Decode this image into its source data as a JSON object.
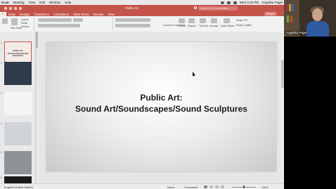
{
  "menubar": {
    "app": "m.us",
    "items": [
      "Meeting",
      "View",
      "Edit",
      "Window",
      "Help"
    ],
    "status_text": "Wed 3:16 PM",
    "user": "Angelika Pagel"
  },
  "window": {
    "title": "Public Art",
    "search_placeholder": "Search in Presentation"
  },
  "ribbon_tabs": [
    "e",
    "Draw",
    "Design",
    "Transitions",
    "Animations",
    "Slide Show",
    "Review",
    "View"
  ],
  "active_tab_index": 0,
  "share_label": "Share",
  "ribbon": {
    "layout_label": "Layout",
    "reset_label": "Reset",
    "section_label": "Section",
    "new_slide_label": "New Slide",
    "picture_label": "Picture",
    "shapes_label": "Shapes",
    "text_box_label": "Text Box",
    "convert_label": "Convert to SmartArt",
    "arrange_label": "Arrange",
    "quick_styles_label": "Quick Styles",
    "shape_fill_label": "Shape Fill",
    "shape_outline_label": "Shape Outline"
  },
  "thumbnails": [
    {
      "num": "1",
      "text": "Public Art: Soundscapes/Sound Sculptures",
      "bg": "#f4ece6",
      "selected": true
    },
    {
      "num": "2",
      "text": "",
      "bg": "#2f3a4a",
      "selected": false
    },
    {
      "num": "3",
      "text": "",
      "bg": "#f5f5f5",
      "selected": false
    },
    {
      "num": "4",
      "text": "",
      "bg": "#d0d4d8",
      "selected": false
    },
    {
      "num": "5",
      "text": "",
      "bg": "#8e9296",
      "selected": false
    },
    {
      "num": "6",
      "text": "",
      "bg": "#1a1a1a",
      "selected": false
    }
  ],
  "slide": {
    "title_line1": "Public Art:",
    "title_line2": "Sound Art/Soundscapes/Sound Sculptures"
  },
  "statusbar": {
    "language": "English (United States)",
    "notes_label": "Notes",
    "comments_label": "Comments",
    "zoom": "115%"
  },
  "participant": {
    "name": "Angelika Pagel"
  }
}
